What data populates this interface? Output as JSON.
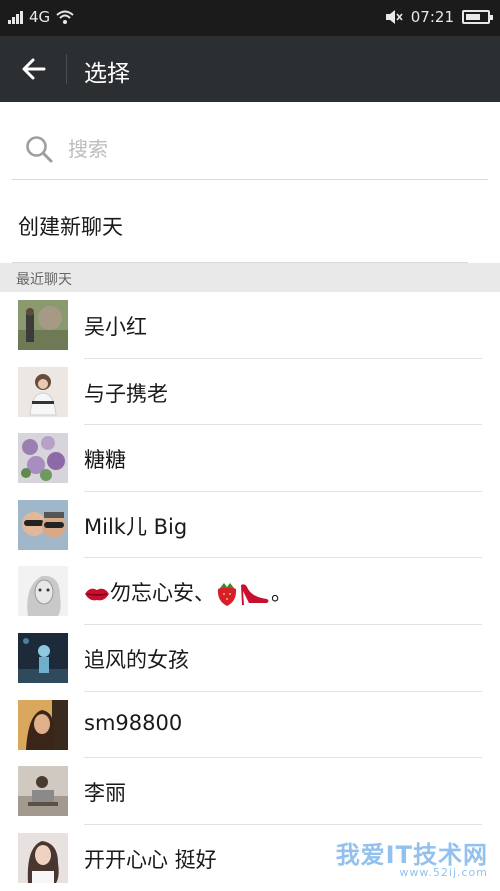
{
  "status_bar": {
    "network": "4G",
    "time": "07:21",
    "battery_level": 0.7
  },
  "header": {
    "title": "选择"
  },
  "search": {
    "placeholder": "搜索",
    "value": ""
  },
  "new_chat_label": "创建新聊天",
  "section_label": "最近聊天",
  "contacts": [
    {
      "name": "吴小红"
    },
    {
      "name": "与子携老"
    },
    {
      "name": "糖糖"
    },
    {
      "name": "Milk儿  Big"
    },
    {
      "name": "勿忘心安、",
      "suffix": "。"
    },
    {
      "name": "追风的女孩"
    },
    {
      "name": "sm98800"
    },
    {
      "name": "李丽"
    },
    {
      "name": "开开心心  挺好"
    }
  ],
  "watermark": {
    "brand": "我爱IT技术网",
    "url": "www.52ij.com"
  }
}
